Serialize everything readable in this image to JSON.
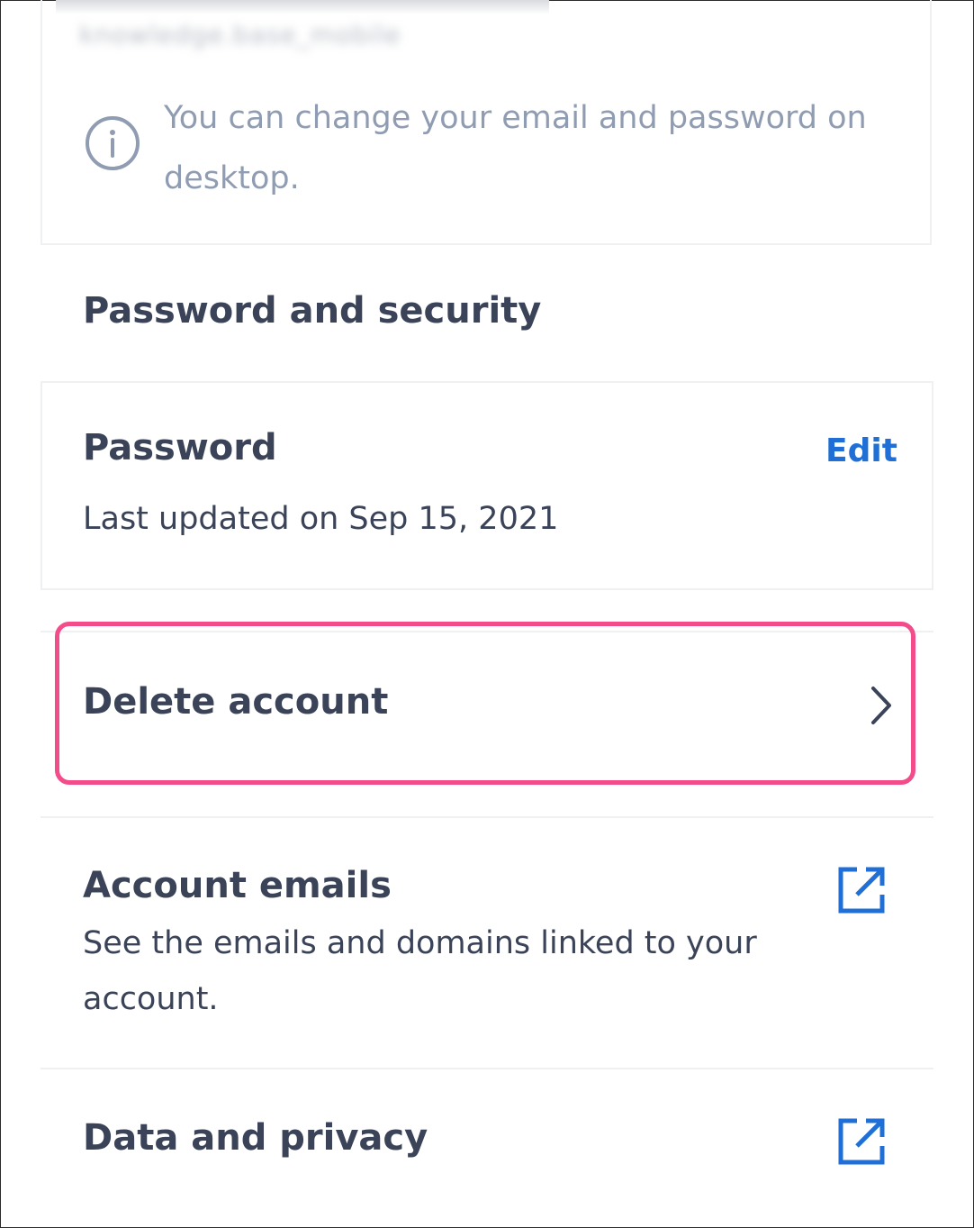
{
  "email_card": {
    "blurred_email": "knowledge.base_mobile",
    "info_text": "You can change your email and password on desktop."
  },
  "security": {
    "heading": "Password and security",
    "password": {
      "title": "Password",
      "edit_label": "Edit",
      "last_updated": "Last updated on Sep 15, 2021"
    }
  },
  "rows": {
    "delete_account": "Delete account",
    "account_emails": {
      "title": "Account emails",
      "description": "See the emails and domains linked to your account."
    },
    "data_privacy": "Data and privacy"
  },
  "colors": {
    "accent": "#1f6fd6",
    "highlight": "#f24c8a",
    "text": "#3a4358",
    "muted": "#8f9cb2"
  },
  "icons": {
    "info": "info-icon",
    "chevron": "chevron-right-icon",
    "external": "external-link-icon"
  }
}
